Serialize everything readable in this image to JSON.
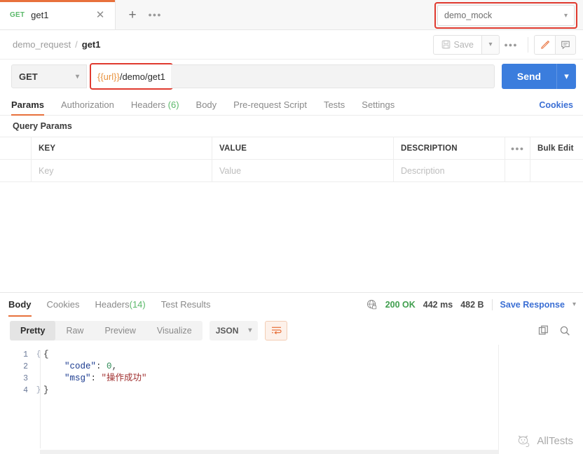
{
  "tabbar": {
    "tabs": [
      {
        "method": "GET",
        "title": "get1",
        "close_icon": "close-icon"
      }
    ],
    "add_icon": "plus-icon",
    "more_icon": "more-horizontal-icon",
    "environment": {
      "selected": "demo_mock",
      "chevron": "chevron-down-icon"
    }
  },
  "breadcrumb": {
    "collection": "demo_request",
    "separator": "/",
    "current": "get1",
    "save_label": "Save",
    "save_icon": "save-disk-icon",
    "save_caret": "chevron-down-icon",
    "more_icon": "more-horizontal-icon",
    "edit_icon": "pencil-icon",
    "comment_icon": "comment-icon"
  },
  "request": {
    "method": "GET",
    "method_chevron": "chevron-down-icon",
    "url_variable": "{{url}}",
    "url_path": "/demo/get1",
    "send_label": "Send",
    "send_caret": "chevron-down-icon"
  },
  "request_tabs": [
    {
      "label": "Params",
      "count": "",
      "active": true
    },
    {
      "label": "Authorization",
      "count": "",
      "active": false
    },
    {
      "label": "Headers",
      "count": "(6)",
      "active": false
    },
    {
      "label": "Body",
      "count": "",
      "active": false
    },
    {
      "label": "Pre-request Script",
      "count": "",
      "active": false
    },
    {
      "label": "Tests",
      "count": "",
      "active": false
    },
    {
      "label": "Settings",
      "count": "",
      "active": false
    }
  ],
  "cookies_link": "Cookies",
  "query_params": {
    "section_label": "Query Params",
    "columns": [
      "KEY",
      "VALUE",
      "DESCRIPTION"
    ],
    "tools_icon": "more-horizontal-icon",
    "bulk_edit_label": "Bulk Edit",
    "empty_row": {
      "key_placeholder": "Key",
      "value_placeholder": "Value",
      "description_placeholder": "Description"
    }
  },
  "response": {
    "tabs": [
      {
        "label": "Body",
        "count": "",
        "active": true
      },
      {
        "label": "Cookies",
        "count": "",
        "active": false
      },
      {
        "label": "Headers",
        "count": "(14)",
        "active": false
      },
      {
        "label": "Test Results",
        "count": "",
        "active": false
      }
    ],
    "status_icon": "globe-lock-icon",
    "status": "200 OK",
    "time": "442 ms",
    "size": "482 B",
    "save_response_label": "Save Response",
    "save_response_caret": "chevron-down-icon",
    "view_modes": [
      {
        "label": "Pretty",
        "active": true
      },
      {
        "label": "Raw",
        "active": false
      },
      {
        "label": "Preview",
        "active": false
      },
      {
        "label": "Visualize",
        "active": false
      }
    ],
    "format": "JSON",
    "format_caret": "chevron-down-icon",
    "wrap_icon": "word-wrap-icon",
    "copy_icon": "copy-icon",
    "search_icon": "search-icon",
    "body_lines": [
      {
        "num": "1",
        "fold": "{",
        "segments": [
          {
            "t": "{",
            "c": "c-punct"
          }
        ]
      },
      {
        "num": "2",
        "fold": "",
        "segments": [
          {
            "t": "    ",
            "c": "c-punct"
          },
          {
            "t": "\"code\"",
            "c": "c-key"
          },
          {
            "t": ": ",
            "c": "c-punct"
          },
          {
            "t": "0",
            "c": "c-num"
          },
          {
            "t": ",",
            "c": "c-punct"
          }
        ]
      },
      {
        "num": "3",
        "fold": "",
        "segments": [
          {
            "t": "    ",
            "c": "c-punct"
          },
          {
            "t": "\"msg\"",
            "c": "c-key"
          },
          {
            "t": ": ",
            "c": "c-punct"
          },
          {
            "t": "\"操作成功\"",
            "c": "c-str"
          }
        ]
      },
      {
        "num": "4",
        "fold": "}",
        "segments": [
          {
            "t": "}",
            "c": "c-punct"
          }
        ]
      }
    ]
  },
  "watermark": {
    "text": "AllTests",
    "icon": "wechat-cat-logo-icon"
  },
  "colors": {
    "accent_orange": "#e8713c",
    "send_blue": "#3b7ddd",
    "link_blue": "#3b6fd4",
    "success_green": "#5bb96a",
    "annotation_red": "#e03a2f"
  }
}
